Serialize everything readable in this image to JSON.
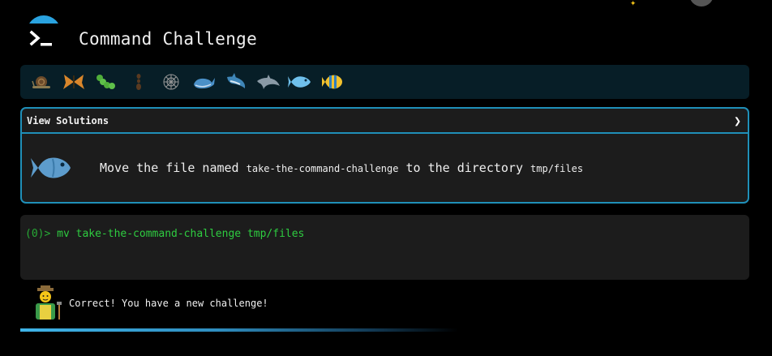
{
  "app": {
    "title": "Command Challenge"
  },
  "levels": [
    {
      "name": "snail-icon"
    },
    {
      "name": "butterfly-icon"
    },
    {
      "name": "caterpillar-icon"
    },
    {
      "name": "ant-icon"
    },
    {
      "name": "spider-web-icon"
    },
    {
      "name": "whale-icon"
    },
    {
      "name": "shark-icon"
    },
    {
      "name": "dolphin-icon"
    },
    {
      "name": "blue-fish-icon",
      "active": true
    },
    {
      "name": "tropical-fish-icon"
    }
  ],
  "challenge": {
    "view_solutions_label": "View Solutions",
    "chevron": "❯",
    "text_prefix": "Move the file named",
    "file_name": "take-the-command-challenge",
    "text_middle": "to the directory",
    "dir_name": "tmp/files"
  },
  "terminal": {
    "prompt": "(0)>",
    "command": "mv take-the-command-challenge tmp/files"
  },
  "feedback": {
    "message": "Correct! You have a new challenge!"
  },
  "colors": {
    "accent": "#1f8fb8",
    "terminal_green": "#2ecc40",
    "progress": "#3fb4e8"
  }
}
